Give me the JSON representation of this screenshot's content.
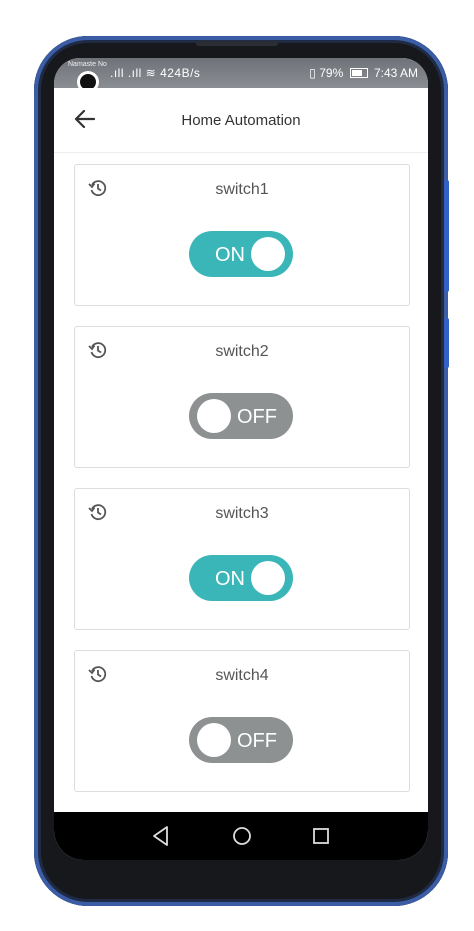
{
  "status_bar": {
    "carrier": "Namaste No",
    "net_speed": "424B/s",
    "battery": "79%",
    "time": "7:43 AM"
  },
  "app_bar": {
    "title": "Home Automation",
    "back_icon": "arrow-left-icon"
  },
  "switches": [
    {
      "name": "switch1",
      "state": "ON",
      "history_icon": "history-icon"
    },
    {
      "name": "switch2",
      "state": "OFF",
      "history_icon": "history-icon"
    },
    {
      "name": "switch3",
      "state": "ON",
      "history_icon": "history-icon"
    },
    {
      "name": "switch4",
      "state": "OFF",
      "history_icon": "history-icon"
    }
  ],
  "nav_bar": {
    "icons": [
      "back-triangle-icon",
      "home-circle-icon",
      "recents-square-icon"
    ]
  },
  "colors": {
    "toggle_on": "#3ab5b8",
    "toggle_off": "#8e9191",
    "phone_frame": "#3b5da6"
  }
}
